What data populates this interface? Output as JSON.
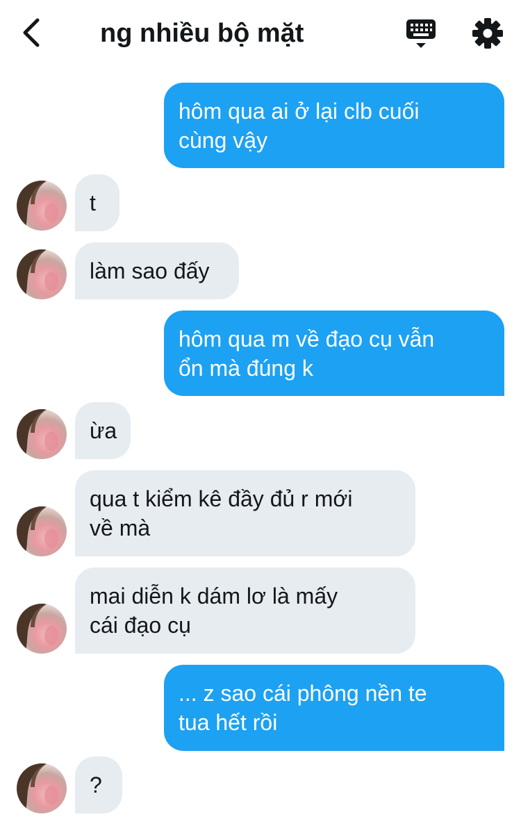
{
  "header": {
    "title": "ng nhiều bộ mặt",
    "back_icon": "chevron-left-icon",
    "keyboard_icon": "keyboard-icon",
    "settings_icon": "gear-icon"
  },
  "colors": {
    "outgoing_bubble": "#1da1f2",
    "incoming_bubble": "#e6ecf0",
    "text_dark": "#14171a"
  },
  "messages": [
    {
      "direction": "out",
      "text": "hôm qua ai ở lại clb cuối\ncùng vậy"
    },
    {
      "direction": "in",
      "text": "t"
    },
    {
      "direction": "in",
      "text": "làm sao đấy"
    },
    {
      "direction": "out",
      "text": "hôm qua m về đạo cụ vẫn\nổn mà đúng k"
    },
    {
      "direction": "in",
      "text": "ừa"
    },
    {
      "direction": "in",
      "text": "qua t kiểm kê đầy đủ r mới\nvề mà"
    },
    {
      "direction": "in",
      "text": "mai diễn k dám lơ là mấy\ncái đạo cụ"
    },
    {
      "direction": "out",
      "text": "... z sao cái phông nền te\ntua hết rồi"
    },
    {
      "direction": "in",
      "text": "?"
    }
  ]
}
